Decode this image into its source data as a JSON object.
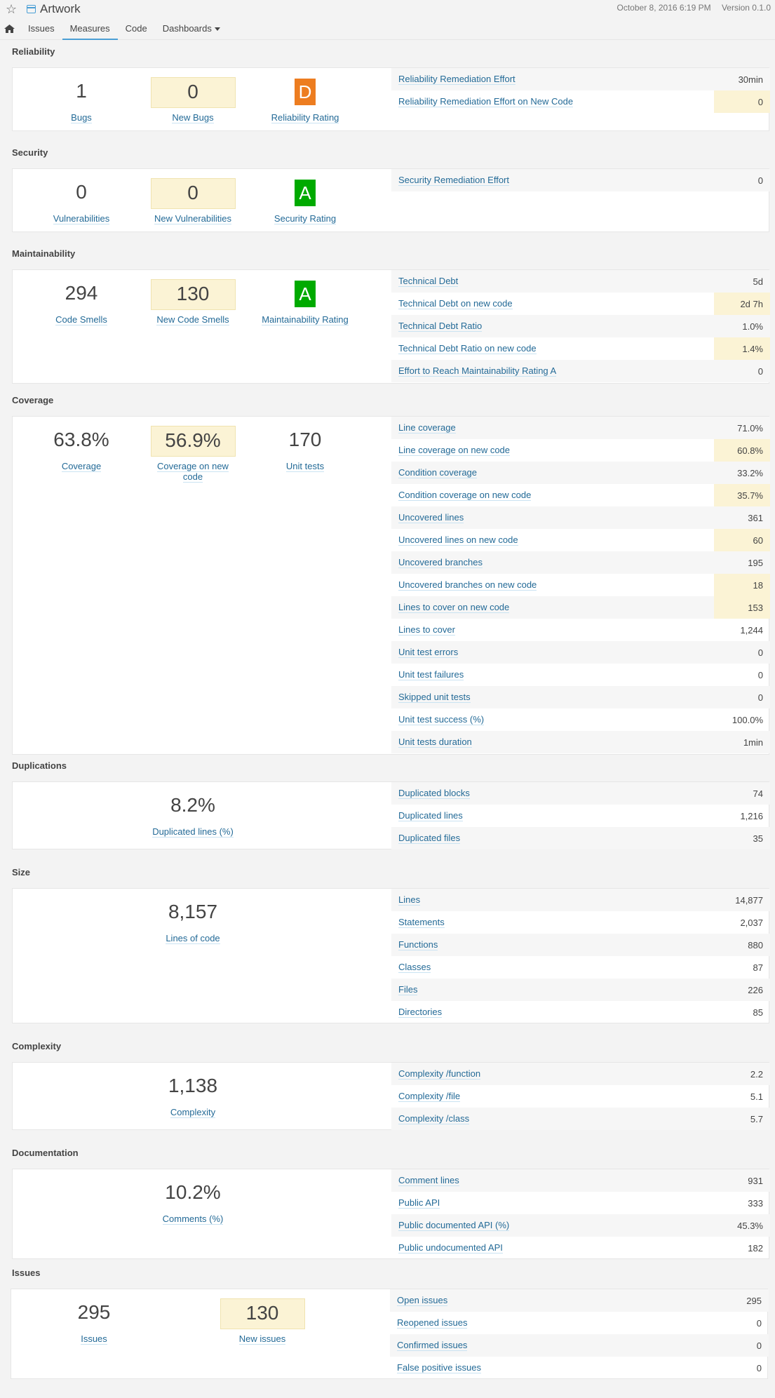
{
  "header": {
    "project_name": "Artwork",
    "date": "October 8, 2016 6:19 PM",
    "version": "Version 0.1.0"
  },
  "tabs": {
    "issues": "Issues",
    "measures": "Measures",
    "code": "Code",
    "dashboards": "Dashboards"
  },
  "colors": {
    "rating_d": "#ed7d20",
    "rating_a": "#00aa00",
    "leak": "#fbf3d5",
    "link": "#236a97"
  },
  "reliability": {
    "title": "Reliability",
    "big": [
      {
        "value": "1",
        "label": "Bugs"
      },
      {
        "value": "0",
        "label": "New Bugs"
      },
      {
        "value": "D",
        "label": "Reliability Rating"
      }
    ],
    "rows": [
      {
        "label": "Reliability Remediation Effort",
        "value": "30min"
      },
      {
        "label": "Reliability Remediation Effort on New Code",
        "value": "0"
      }
    ]
  },
  "security": {
    "title": "Security",
    "big": [
      {
        "value": "0",
        "label": "Vulnerabilities"
      },
      {
        "value": "0",
        "label": "New Vulnerabilities"
      },
      {
        "value": "A",
        "label": "Security Rating"
      }
    ],
    "rows": [
      {
        "label": "Security Remediation Effort",
        "value": "0"
      }
    ]
  },
  "maintainability": {
    "title": "Maintainability",
    "big": [
      {
        "value": "294",
        "label": "Code Smells"
      },
      {
        "value": "130",
        "label": "New Code Smells"
      },
      {
        "value": "A",
        "label": "Maintainability Rating"
      }
    ],
    "rows": [
      {
        "label": "Technical Debt",
        "value": "5d"
      },
      {
        "label": "Technical Debt on new code",
        "value": "2d 7h"
      },
      {
        "label": "Technical Debt Ratio",
        "value": "1.0%"
      },
      {
        "label": "Technical Debt Ratio on new code",
        "value": "1.4%"
      },
      {
        "label": "Effort to Reach Maintainability Rating A",
        "value": "0"
      }
    ]
  },
  "coverage": {
    "title": "Coverage",
    "big": [
      {
        "value": "63.8%",
        "label": "Coverage"
      },
      {
        "value": "56.9%",
        "label": "Coverage on new code"
      },
      {
        "value": "170",
        "label": "Unit tests"
      }
    ],
    "rows": [
      {
        "label": "Line coverage",
        "value": "71.0%"
      },
      {
        "label": "Line coverage on new code",
        "value": "60.8%"
      },
      {
        "label": "Condition coverage",
        "value": "33.2%"
      },
      {
        "label": "Condition coverage on new code",
        "value": "35.7%"
      },
      {
        "label": "Uncovered lines",
        "value": "361"
      },
      {
        "label": "Uncovered lines on new code",
        "value": "60"
      },
      {
        "label": "Uncovered branches",
        "value": "195"
      },
      {
        "label": "Uncovered branches on new code",
        "value": "18"
      },
      {
        "label": "Lines to cover on new code",
        "value": "153"
      },
      {
        "label": "Lines to cover",
        "value": "1,244"
      },
      {
        "label": "Unit test errors",
        "value": "0"
      },
      {
        "label": "Unit test failures",
        "value": "0"
      },
      {
        "label": "Skipped unit tests",
        "value": "0"
      },
      {
        "label": "Unit test success (%)",
        "value": "100.0%"
      },
      {
        "label": "Unit tests duration",
        "value": "1min"
      }
    ]
  },
  "duplications": {
    "title": "Duplications",
    "big": [
      {
        "value": "8.2%",
        "label": "Duplicated lines (%)"
      }
    ],
    "rows": [
      {
        "label": "Duplicated blocks",
        "value": "74"
      },
      {
        "label": "Duplicated lines",
        "value": "1,216"
      },
      {
        "label": "Duplicated files",
        "value": "35"
      }
    ]
  },
  "size": {
    "title": "Size",
    "big": [
      {
        "value": "8,157",
        "label": "Lines of code"
      }
    ],
    "rows": [
      {
        "label": "Lines",
        "value": "14,877"
      },
      {
        "label": "Statements",
        "value": "2,037"
      },
      {
        "label": "Functions",
        "value": "880"
      },
      {
        "label": "Classes",
        "value": "87"
      },
      {
        "label": "Files",
        "value": "226"
      },
      {
        "label": "Directories",
        "value": "85"
      }
    ]
  },
  "complexity": {
    "title": "Complexity",
    "big": [
      {
        "value": "1,138",
        "label": "Complexity"
      }
    ],
    "rows": [
      {
        "label": "Complexity /function",
        "value": "2.2"
      },
      {
        "label": "Complexity /file",
        "value": "5.1"
      },
      {
        "label": "Complexity /class",
        "value": "5.7"
      }
    ]
  },
  "documentation": {
    "title": "Documentation",
    "big": [
      {
        "value": "10.2%",
        "label": "Comments (%)"
      }
    ],
    "rows": [
      {
        "label": "Comment lines",
        "value": "931"
      },
      {
        "label": "Public API",
        "value": "333"
      },
      {
        "label": "Public documented API (%)",
        "value": "45.3%"
      },
      {
        "label": "Public undocumented API",
        "value": "182"
      }
    ]
  },
  "issues": {
    "title": "Issues",
    "big": [
      {
        "value": "295",
        "label": "Issues"
      },
      {
        "value": "130",
        "label": "New issues"
      }
    ],
    "rows": [
      {
        "label": "Open issues",
        "value": "295"
      },
      {
        "label": "Reopened issues",
        "value": "0"
      },
      {
        "label": "Confirmed issues",
        "value": "0"
      },
      {
        "label": "False positive issues",
        "value": "0"
      }
    ]
  }
}
